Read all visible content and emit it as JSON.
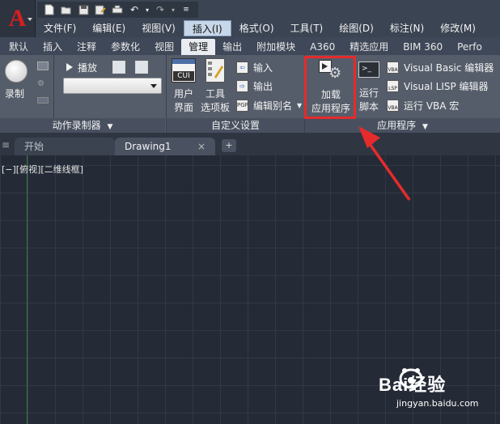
{
  "title_bar": {
    "qat_icons": [
      "new-icon",
      "open-icon",
      "save-icon",
      "saveas-icon",
      "print-icon",
      "undo-icon",
      "redo-icon",
      "customize-icon"
    ]
  },
  "menu": [
    "文件(F)",
    "编辑(E)",
    "视图(V)",
    "插入(I)",
    "格式(O)",
    "工具(T)",
    "绘图(D)",
    "标注(N)",
    "修改(M)"
  ],
  "ribbon_tabs": [
    "默认",
    "插入",
    "注释",
    "参数化",
    "视图",
    "管理",
    "输出",
    "附加模块",
    "A360",
    "精选应用",
    "BIM 360",
    "Perfo"
  ],
  "active_tab": "管理",
  "panels": {
    "action_recorder": {
      "title": "动作录制器",
      "record_label": "录制",
      "play_label": "播放"
    },
    "customize": {
      "title": "自定义设置",
      "user_interface_l1": "用户",
      "user_interface_l2": "界面",
      "cui_badge": "CUI",
      "tool_palettes_l1": "工具",
      "tool_palettes_l2": "选项板",
      "import_label": "输入",
      "export_label": "输出",
      "edit_alias_label": "编辑别名"
    },
    "applications": {
      "title": "应用程序",
      "load_app_l1": "加载",
      "load_app_l2": "应用程序",
      "run_script_l1": "运行",
      "run_script_l2": "脚本",
      "vb_editor": "Visual Basic 编辑器",
      "lisp_editor": "Visual LISP 编辑器",
      "run_vba": "运行 VBA 宏"
    }
  },
  "doc_tabs": {
    "start": "开始",
    "drawing": "Drawing1",
    "close": "×",
    "add": "+"
  },
  "viewport_label": "[−][俯视][二维线框]",
  "watermark": {
    "brand": "Bai经验",
    "url": "jingyan.baidu.com"
  },
  "colors": {
    "accent_red": "#e52b2b",
    "canvas_bg": "#252b36",
    "ribbon_bg": "#555d6a"
  }
}
